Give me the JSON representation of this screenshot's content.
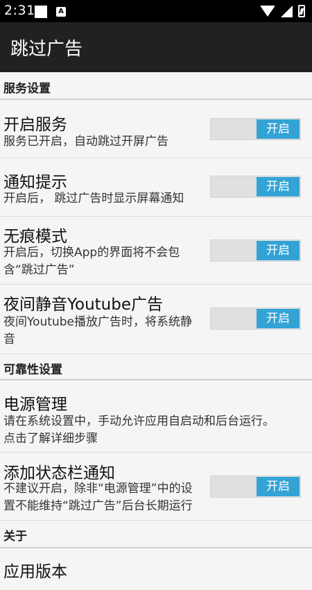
{
  "status_bar": {
    "time": "2:31",
    "notification_badge": "A"
  },
  "app_bar": {
    "title": "跳过广告"
  },
  "sections": {
    "service": {
      "header": "服务设置",
      "enable_service": {
        "title": "开启服务",
        "summary": "服务已开启，自动跳过开屏广告",
        "toggle_label": "开启"
      },
      "notification": {
        "title": "通知提示",
        "summary": "开启后， 跳过广告时显示屏幕通知",
        "toggle_label": "开启"
      },
      "incognito": {
        "title": "无痕模式",
        "summary_line1": "开启后，切换App的界面将不会包",
        "summary_line2": "含“跳过广告”",
        "toggle_label": "开启"
      },
      "youtube_mute": {
        "title": "夜间静音Youtube广告",
        "summary_line1": "夜间Youtube播放广告时，将系统静",
        "summary_line2": "音",
        "toggle_label": "开启"
      }
    },
    "reliability": {
      "header": "可靠性设置",
      "power": {
        "title": "电源管理",
        "summary_line1": "请在系统设置中，手动允许应用自启动和后台运行。",
        "summary_line2": "点击了解详细步骤"
      },
      "status_notification": {
        "title": "添加状态栏通知",
        "summary_line1": "不建议开启，除非“电源管理”中的设",
        "summary_line2": "置不能维持“跳过广告”后台长期运行",
        "toggle_label": "开启"
      }
    },
    "about": {
      "header": "关于",
      "app_version": {
        "title": "应用版本"
      }
    }
  }
}
